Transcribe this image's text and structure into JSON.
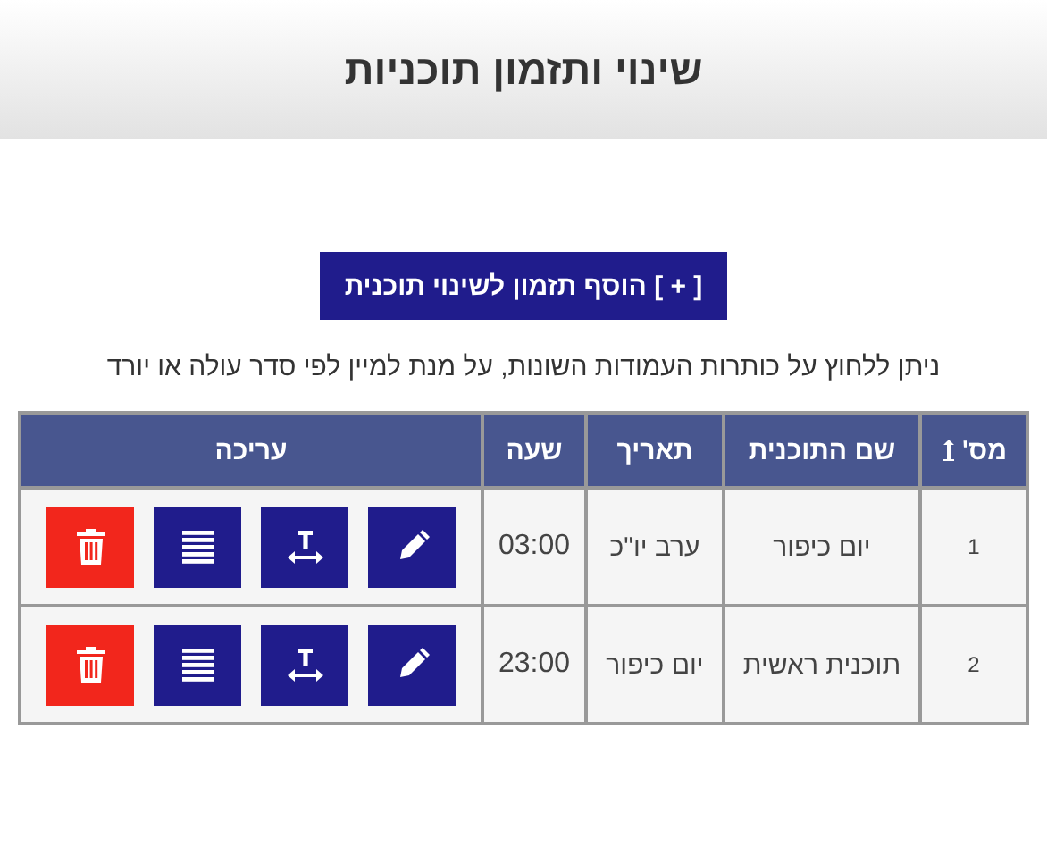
{
  "title": "שינוי ותזמון תוכניות",
  "add_button": "[ + ] הוסף תזמון לשינוי תוכנית",
  "hint": "ניתן ללחוץ על כותרות העמודות השונות, על מנת למיין לפי סדר עולה או יורד",
  "table": {
    "columns": [
      {
        "label": "מס'",
        "sortable": true
      },
      {
        "label": "שם התוכנית",
        "sortable": false
      },
      {
        "label": "תאריך",
        "sortable": false
      },
      {
        "label": "שעה",
        "sortable": false
      },
      {
        "label": "עריכה",
        "sortable": false
      }
    ],
    "rows": [
      {
        "number": "1",
        "name": "יום כיפור",
        "date": "ערב יו\"כ",
        "time": "03:00"
      },
      {
        "number": "2",
        "name": "תוכנית ראשית",
        "date": "יום כיפור",
        "time": "23:00"
      }
    ]
  }
}
